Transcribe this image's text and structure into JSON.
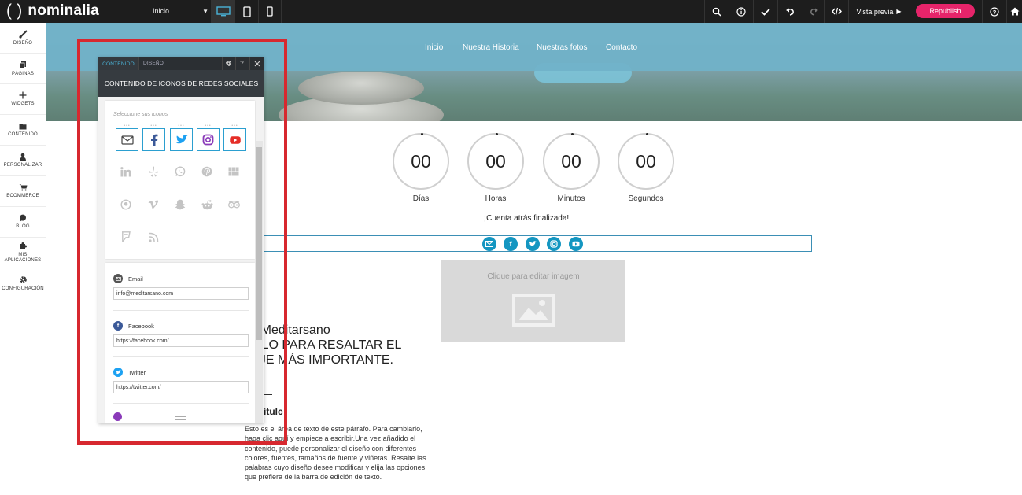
{
  "topbar": {
    "logo_paren": "( )",
    "logo_text": "nominalia",
    "page_select_value": "Inicio",
    "preview_label": "Vista previa",
    "republish_label": "Republish"
  },
  "sidebar": {
    "items": [
      {
        "label": "DISEÑO",
        "icon": "brush-icon"
      },
      {
        "label": "PÁGINAS",
        "icon": "pages-icon"
      },
      {
        "label": "WIDGETS",
        "icon": "plus-icon"
      },
      {
        "label": "CONTENIDO",
        "icon": "folder-icon"
      },
      {
        "label": "PERSONALIZAR",
        "icon": "person-icon"
      },
      {
        "label": "ECOMMERCE",
        "icon": "cart-icon"
      },
      {
        "label": "BLOG",
        "icon": "speech-bubble-icon"
      },
      {
        "label": "MIS APLICACIONES",
        "icon": "puzzle-icon"
      },
      {
        "label": "CONFIGURACIÓN",
        "icon": "gear-icon"
      }
    ]
  },
  "site": {
    "nav": [
      "Inicio",
      "Nuestra Historia",
      "Nuestras fotos",
      "Contacto"
    ],
    "countdown": {
      "values": [
        "00",
        "00",
        "00",
        "00"
      ],
      "labels": [
        "Días",
        "Horas",
        "Minutos",
        "Segundos"
      ],
      "finished": "¡Cuenta atrás finalizada!"
    },
    "image_placeholder": "Clique para editar imagem",
    "heading_line1": "mos Meditarsano",
    "heading_line2": "LÍCELO PARA RESALTAR EL",
    "heading_line3": "NSAJE MÁS IMPORTANTE.",
    "subtitle": "títulc",
    "paragraph": "Esto es el área de texto de este párrafo. Para cambiarlo, haga clic aquí y empiece a escribir.Una vez añadido el contenido, puede personalizar el diseño con diferentes colores, fuentes, tamaños de fuente y viñetas. Resalte las palabras cuyo diseño desee modificar y elija las opciones que prefiera de la barra de edición de texto."
  },
  "panel": {
    "tab_content": "CONTENIDO",
    "tab_design": "DISEÑO",
    "help": "?",
    "title": "CONTENIDO DE ICONOS DE REDES SOCIALES",
    "select_label": "Seleccione sus iconos",
    "networks": [
      {
        "name": "Email",
        "value": "info@meditarsano.com",
        "color": "#555555"
      },
      {
        "name": "Facebook",
        "value": "https://facebook.com/",
        "color": "#3b5998"
      },
      {
        "name": "Twitter",
        "value": "https://twitter.com/",
        "color": "#1da1f2"
      }
    ]
  },
  "colors": {
    "accent": "#1496c1",
    "republish": "#e6246a",
    "highlight": "#d7282f",
    "nav_bg": "#70b2c9"
  }
}
